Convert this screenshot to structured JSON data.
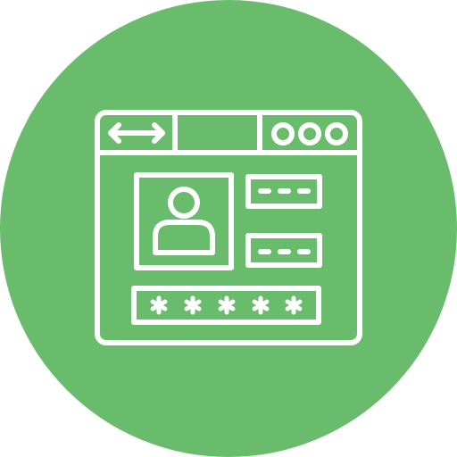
{
  "icon": {
    "name": "user-login-browser-window-icon",
    "colors": {
      "background_circle": "#69BC6B",
      "stroke": "#FFFFFF"
    },
    "elements": {
      "navigation_arrows": "left-right-arrow-icon",
      "address_bar": "address-bar",
      "window_controls": "three-circle-icons",
      "profile_picture": "user-avatar-icon",
      "username_field": "dashed-input-field",
      "email_field": "dashed-input-field",
      "password_field": "asterisk-password-field"
    }
  }
}
